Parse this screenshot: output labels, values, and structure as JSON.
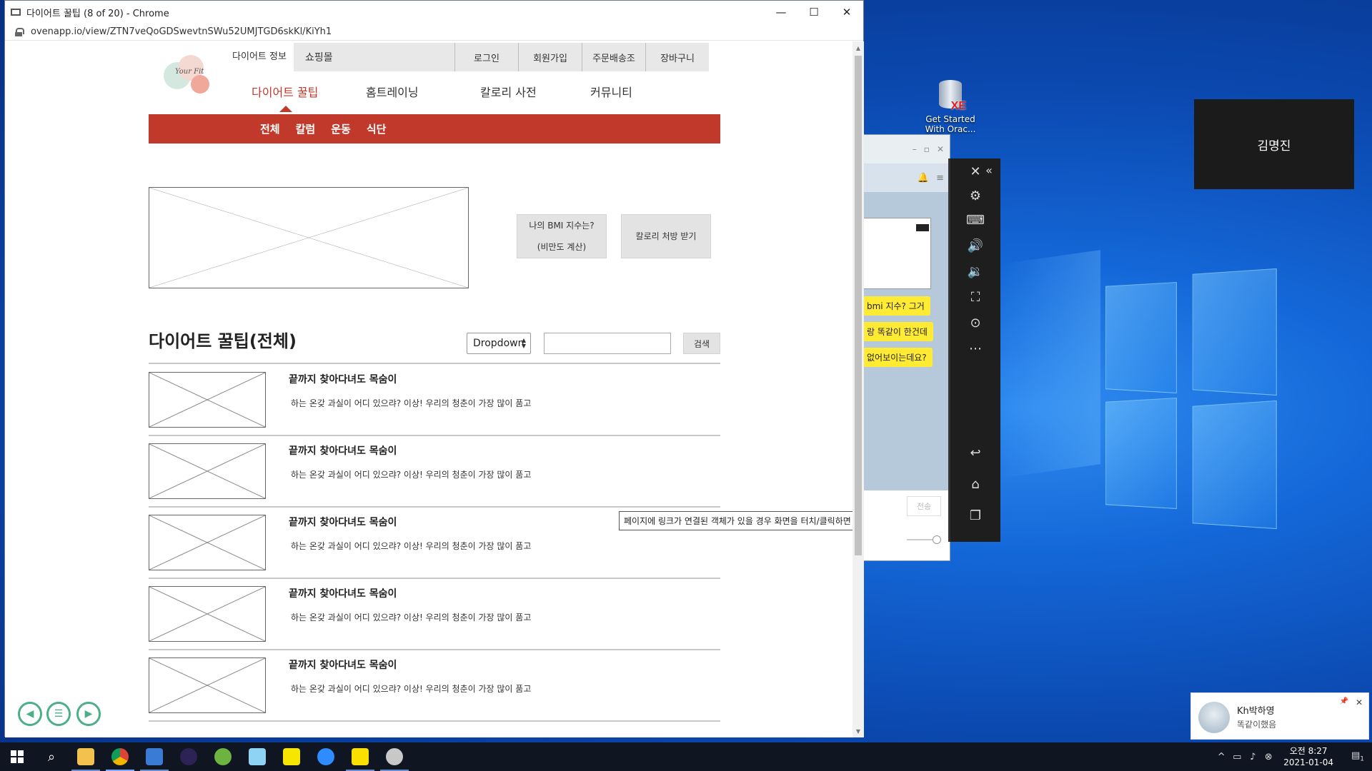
{
  "browser": {
    "window_title": "다이어트 꿀팁 (8 of 20) - Chrome",
    "url": "ovenapp.io/view/ZTN7veQoGDSwevtnSWu52UMJTGD6skKl/KiYh1",
    "minimize": "—",
    "maximize": "☐",
    "close": "✕"
  },
  "site": {
    "logo_text": "Your Fit",
    "top_nav": {
      "info": "다이어트 정보",
      "shop": "쇼핑몰",
      "utils": [
        "로그인",
        "회원가입",
        "주문배송조",
        "장바구니"
      ]
    },
    "main_nav": [
      "다이어트 꿀팁",
      "홈트레이닝",
      "칼로리 사전",
      "커뮤니티"
    ],
    "sub_nav": [
      "전체",
      "칼럼",
      "운동",
      "식단"
    ],
    "bmi_button": {
      "line1": "나의 BMI 지수는?",
      "line2": "(비만도 계산)"
    },
    "calorie_button": "칼로리 처방 받기",
    "section_title": "다이어트 꿀팁(전체)",
    "dropdown_value": "Dropdown",
    "search_placeholder": "",
    "search_button": "검색",
    "posts": [
      {
        "title": "끝까지 찾아다녀도 목숨이",
        "desc": "하는 온갖 과실이 어디 있으랴? 이상! 우리의 청춘이 가장 많이 품고"
      },
      {
        "title": "끝까지 찾아다녀도 목숨이",
        "desc": "하는 온갖 과실이 어디 있으랴? 이상! 우리의 청춘이 가장 많이 품고"
      },
      {
        "title": "끝까지 찾아다녀도 목숨이",
        "desc": "하는 온갖 과실이 어디 있으랴? 이상! 우리의 청춘이 가장 많이 품고"
      },
      {
        "title": "끝까지 찾아다녀도 목숨이",
        "desc": "하는 온갖 과실이 어디 있으랴? 이상! 우리의 청춘이 가장 많이 품고"
      },
      {
        "title": "끝까지 찾아다녀도 목숨이",
        "desc": "하는 온갖 과실이 어디 있으랴? 이상! 우리의 청춘이 가장 많이 품고"
      }
    ],
    "tooltip": "페이지에 링크가 연결된 객체가 있을 경우 화면을 터치/클릭하면 표시됩니다."
  },
  "desktop": {
    "icon_label_1": "Get Started",
    "icon_label_2": "With Orac...",
    "name_panel": "김명진"
  },
  "chat": {
    "bubbles": [
      "bmi 지수? 그거",
      "랑 똑같이 한건데",
      "없어보이는데요?"
    ],
    "send": "전송"
  },
  "notification": {
    "name": "Kh박하영",
    "message": "똑같이했음"
  },
  "taskbar": {
    "time": "오전 8:27",
    "date": "2021-01-04",
    "notif_count": "1"
  }
}
